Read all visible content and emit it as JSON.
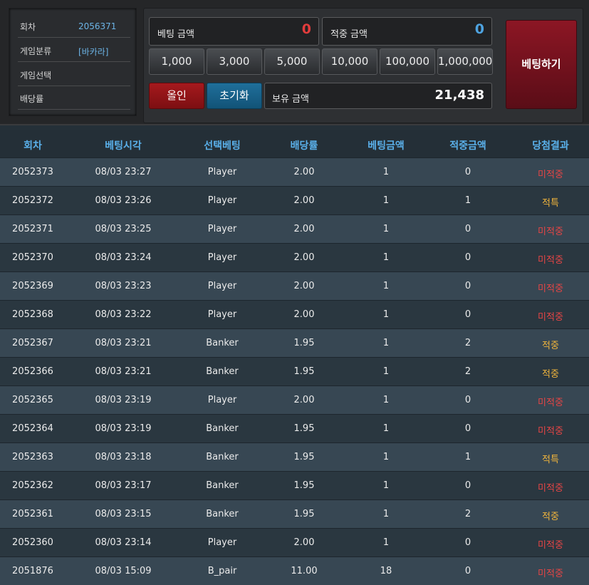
{
  "info": {
    "round_label": "회차",
    "round_value": "2056371",
    "category_label": "게임분류",
    "category_value": "[바카라]",
    "select_label": "게임선택",
    "select_value": "",
    "odds_label": "배당률",
    "odds_value": ""
  },
  "bet": {
    "bet_amount_label": "베팅 금액",
    "bet_amount_value": "0",
    "win_amount_label": "적중 금액",
    "win_amount_value": "0",
    "chips": [
      "1,000",
      "3,000",
      "5,000",
      "10,000",
      "100,000",
      "1,000,000"
    ],
    "allin_label": "올인",
    "reset_label": "초기화",
    "hold_label": "보유 금액",
    "hold_value": "21,438",
    "submit_label": "베팅하기"
  },
  "colors": {
    "bet_value": "#e23c3c",
    "win_value": "#4ea3e0",
    "miss": "#e64545",
    "hit": "#f0b43c",
    "header": "#5ab0ea"
  },
  "table": {
    "headers": [
      "회차",
      "베팅시각",
      "선택베팅",
      "배당률",
      "베팅금액",
      "적중금액",
      "당첨결과"
    ],
    "rows": [
      [
        "2052373",
        "08/03 23:27",
        "Player",
        "2.00",
        "1",
        "0",
        "미적중"
      ],
      [
        "2052372",
        "08/03 23:26",
        "Player",
        "2.00",
        "1",
        "1",
        "적특"
      ],
      [
        "2052371",
        "08/03 23:25",
        "Player",
        "2.00",
        "1",
        "0",
        "미적중"
      ],
      [
        "2052370",
        "08/03 23:24",
        "Player",
        "2.00",
        "1",
        "0",
        "미적중"
      ],
      [
        "2052369",
        "08/03 23:23",
        "Player",
        "2.00",
        "1",
        "0",
        "미적중"
      ],
      [
        "2052368",
        "08/03 23:22",
        "Player",
        "2.00",
        "1",
        "0",
        "미적중"
      ],
      [
        "2052367",
        "08/03 23:21",
        "Banker",
        "1.95",
        "1",
        "2",
        "적중"
      ],
      [
        "2052366",
        "08/03 23:21",
        "Banker",
        "1.95",
        "1",
        "2",
        "적중"
      ],
      [
        "2052365",
        "08/03 23:19",
        "Player",
        "2.00",
        "1",
        "0",
        "미적중"
      ],
      [
        "2052364",
        "08/03 23:19",
        "Banker",
        "1.95",
        "1",
        "0",
        "미적중"
      ],
      [
        "2052363",
        "08/03 23:18",
        "Banker",
        "1.95",
        "1",
        "1",
        "적특"
      ],
      [
        "2052362",
        "08/03 23:17",
        "Banker",
        "1.95",
        "1",
        "0",
        "미적중"
      ],
      [
        "2052361",
        "08/03 23:15",
        "Banker",
        "1.95",
        "1",
        "2",
        "적중"
      ],
      [
        "2052360",
        "08/03 23:14",
        "Player",
        "2.00",
        "1",
        "0",
        "미적중"
      ],
      [
        "2051876",
        "08/03 15:09",
        "B_pair",
        "11.00",
        "18",
        "0",
        "미적중"
      ]
    ]
  }
}
